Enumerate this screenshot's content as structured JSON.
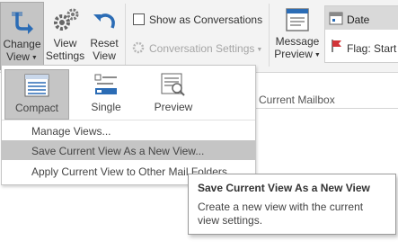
{
  "ribbon": {
    "change_view": {
      "line1": "Change",
      "line2": "View",
      "icon": "change-view-icon"
    },
    "view_settings": {
      "line1": "View",
      "line2": "Settings",
      "icon": "gear-icon"
    },
    "reset_view": {
      "line1": "Reset",
      "line2": "View",
      "icon": "undo-arrow-icon"
    },
    "show_as_conversations": {
      "label": "Show as Conversations",
      "checked": false
    },
    "conversation_settings": {
      "label": "Conversation Settings",
      "enabled": false
    },
    "message_preview": {
      "line1": "Message",
      "line2": "Preview",
      "icon": "message-preview-icon"
    },
    "arrangement": [
      {
        "label": "Date",
        "icon": "calendar-icon",
        "selected": true
      },
      {
        "label": "Flag: Start D",
        "icon": "red-flag-icon",
        "selected": false
      }
    ]
  },
  "search_scope": "Current Mailbox",
  "dropdown": {
    "views": [
      {
        "label": "Compact",
        "icon": "compact-view-icon",
        "selected": true
      },
      {
        "label": "Single",
        "icon": "single-view-icon",
        "selected": false
      },
      {
        "label": "Preview",
        "icon": "preview-view-icon",
        "selected": false
      }
    ],
    "items": [
      {
        "label": "Manage Views...",
        "hover": false
      },
      {
        "label": "Save Current View As a New View...",
        "hover": true
      },
      {
        "label": "Apply Current View to Other Mail Folders...",
        "hover": false
      }
    ]
  },
  "tooltip": {
    "title": "Save Current View As a New View",
    "description": "Create a new view with the current view settings."
  },
  "colors": {
    "ribbon_bg": "#f3f3f3",
    "selected_bg": "#c5c5c5",
    "accent_blue": "#2b6cb5",
    "flag_red": "#d13438"
  }
}
